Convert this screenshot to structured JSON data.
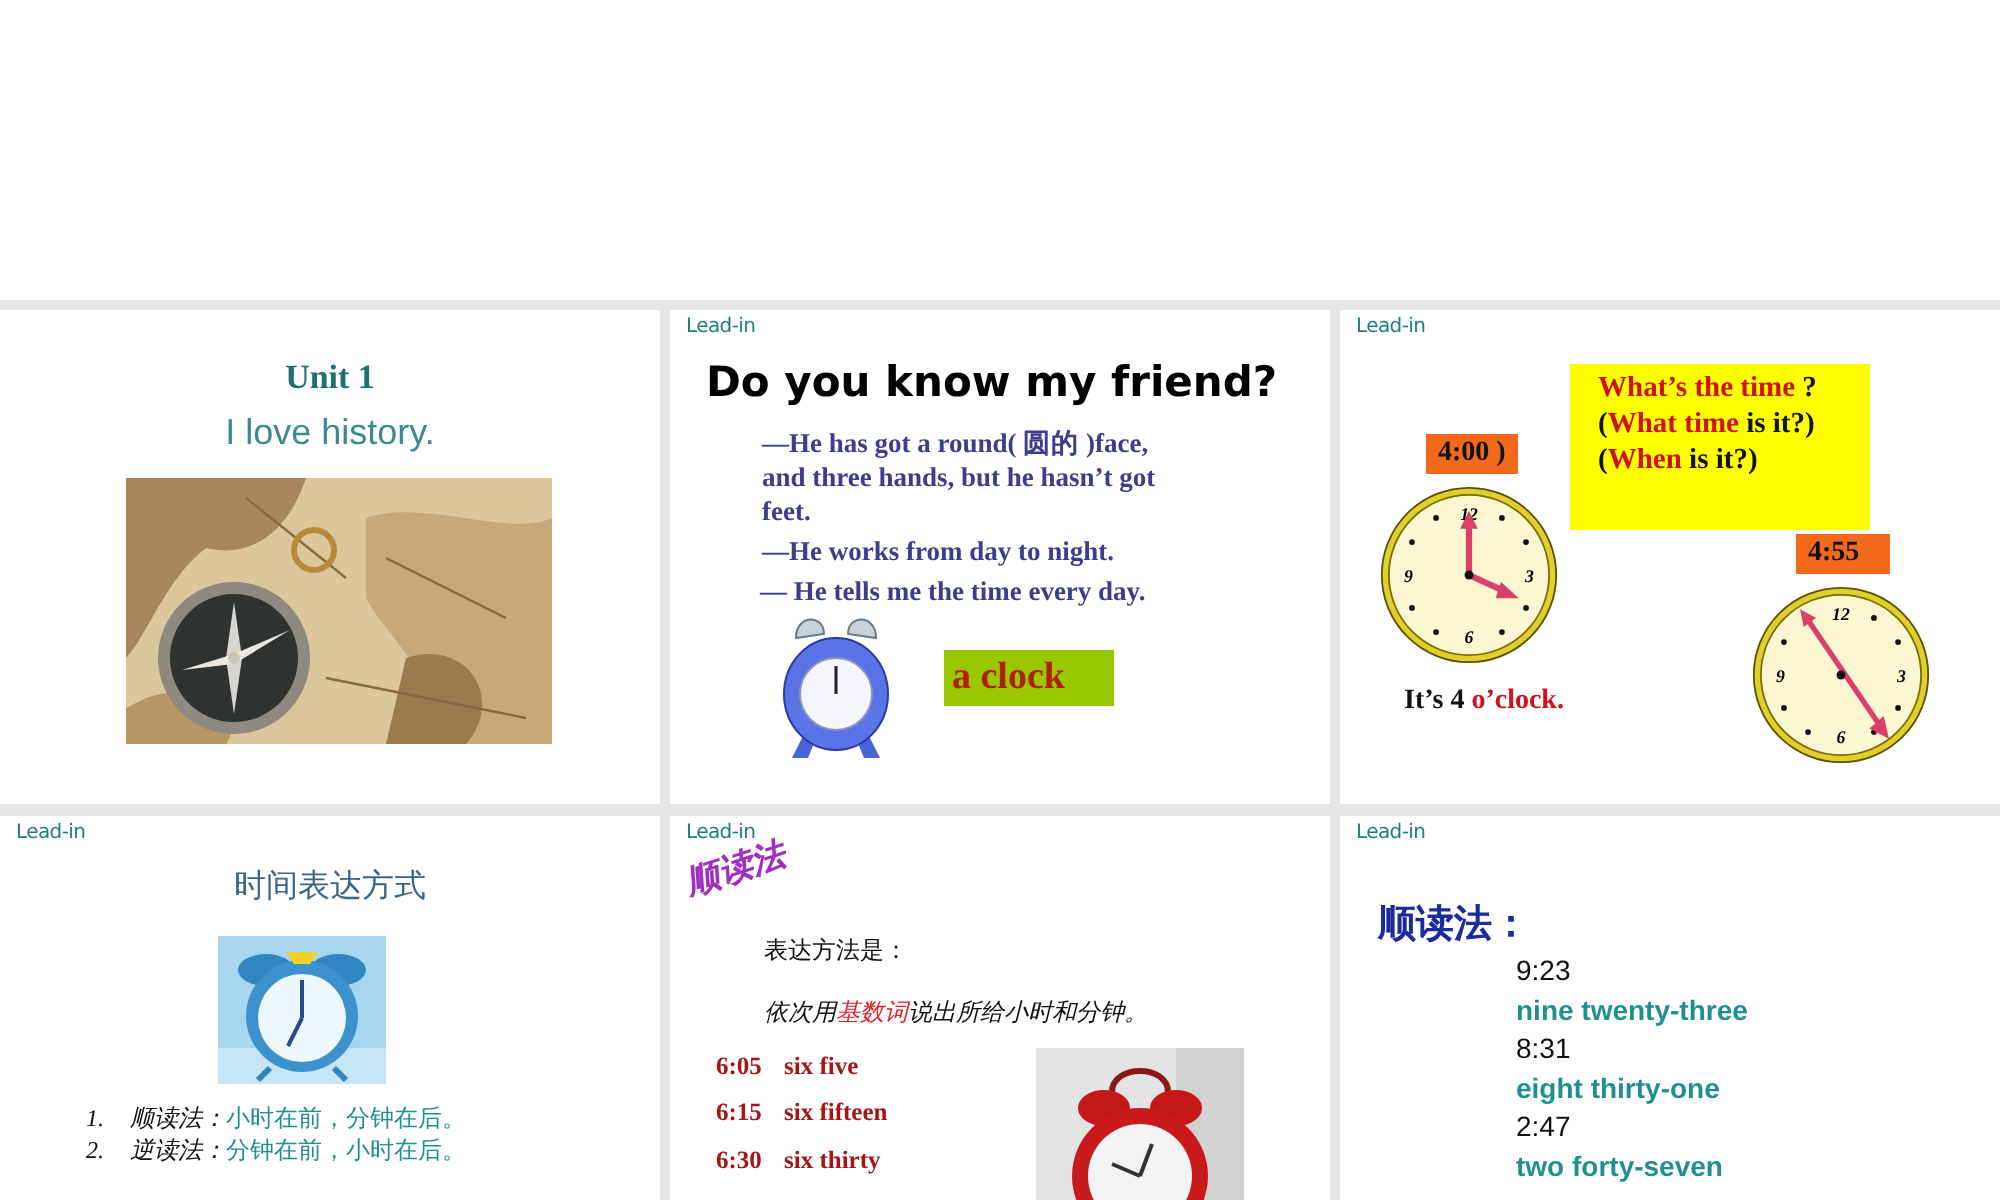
{
  "slides": [
    {
      "kind": "title",
      "title": "Unit 1",
      "subtitle": "I love history."
    },
    {
      "kind": "riddle",
      "label": "Lead-in",
      "title": "Do you know my friend?",
      "lines": [
        "—He has got a round( 圆的 )face, and three hands, but he hasn’t got feet.",
        "—He works from day to night.",
        "— He tells me the time every day."
      ],
      "answer": "a clock"
    },
    {
      "kind": "clocks",
      "label": "Lead-in",
      "questions": [
        [
          {
            "text": "What’s the time",
            "accent": true
          },
          {
            "text": " ?",
            "accent": false
          }
        ],
        [
          {
            "text": "(",
            "accent": false
          },
          {
            "text": "What time",
            "accent": true
          },
          {
            "text": " is it?)",
            "accent": false
          }
        ],
        [
          {
            "text": "(",
            "accent": false
          },
          {
            "text": "When",
            "accent": true
          },
          {
            "text": " is it?)",
            "accent": false
          }
        ]
      ],
      "clocks": [
        {
          "time": "4:00 )",
          "numerals": [
            "12",
            "3",
            "6",
            "9"
          ]
        },
        {
          "time": "4:55",
          "numerals": [
            "12",
            "3",
            "6",
            "9"
          ]
        }
      ],
      "caption": [
        {
          "text": "It’s 4 ",
          "accent": false
        },
        {
          "text": "o’clock.",
          "accent": true
        }
      ]
    },
    {
      "kind": "methods",
      "label": "Lead-in",
      "title": "时间表达方式",
      "items": [
        {
          "number": "1.",
          "term": "顺读法：",
          "text": "小时在前，分钟在后。"
        },
        {
          "number": "2.",
          "term": "逆读法：",
          "text": "分钟在前，小时在后。"
        }
      ]
    },
    {
      "kind": "forward",
      "label": "Lead-in",
      "title": "顺读法",
      "intro": "表达方法是：",
      "rule": [
        {
          "text": "依次用",
          "accent": false
        },
        {
          "text": "基数词",
          "accent": true
        },
        {
          "text": "说出所给小时和分钟。",
          "accent": false
        }
      ],
      "examples": [
        {
          "time": "6:05",
          "words": "six five"
        },
        {
          "time": "6:15",
          "words": "six fifteen"
        },
        {
          "time": "6:30",
          "words": "six thirty"
        }
      ]
    },
    {
      "kind": "readings",
      "label": "Lead-in",
      "title": "顺读法：",
      "lines": [
        {
          "kind": "time",
          "text": "9:23"
        },
        {
          "kind": "words",
          "text": "nine twenty-three"
        },
        {
          "kind": "time",
          "text": "8:31"
        },
        {
          "kind": "words",
          "text": "eight thirty-one"
        },
        {
          "kind": "time",
          "text": "2:47"
        },
        {
          "kind": "words",
          "text": "two forty-seven"
        }
      ]
    }
  ]
}
